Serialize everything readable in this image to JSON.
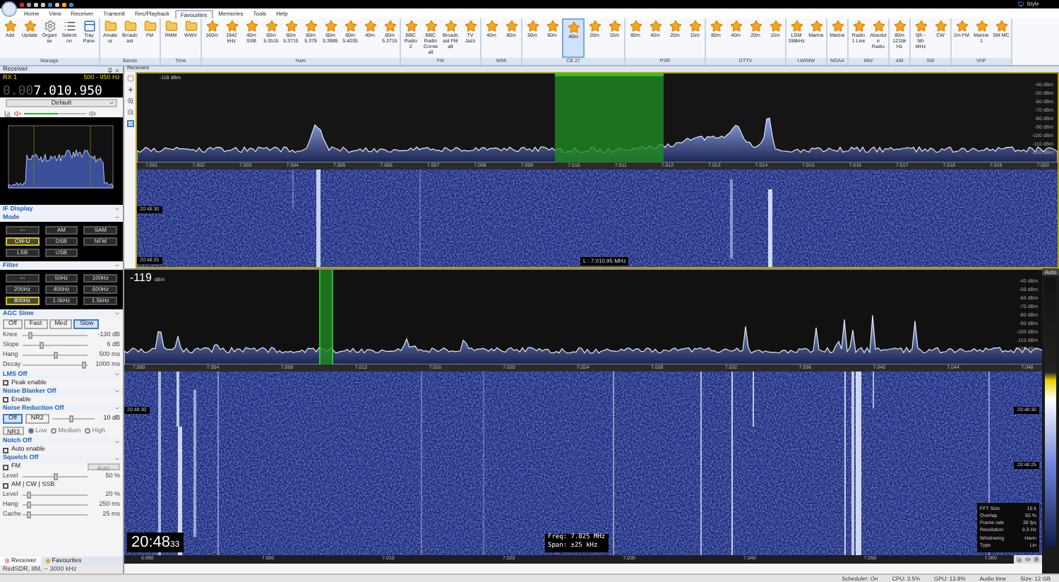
{
  "title_bar": {
    "style_menu": "Style"
  },
  "menu_tabs": [
    {
      "label": "Home",
      "selected": false
    },
    {
      "label": "View",
      "selected": false
    },
    {
      "label": "Receiver",
      "selected": false
    },
    {
      "label": "Transmit",
      "selected": false
    },
    {
      "label": "Rec/Playback",
      "selected": false
    },
    {
      "label": "Favourites",
      "selected": true
    },
    {
      "label": "Memories",
      "selected": false
    },
    {
      "label": "Tools",
      "selected": false
    },
    {
      "label": "Help",
      "selected": false
    }
  ],
  "ribbon_groups": [
    {
      "label": "Manage",
      "items": [
        {
          "label": "Add",
          "kind": "star",
          "selected": false
        },
        {
          "label": "Update",
          "kind": "star",
          "selected": false
        },
        {
          "label": "Organise",
          "kind": "gear",
          "selected": false
        },
        {
          "label": "Selection",
          "kind": "list",
          "selected": false
        },
        {
          "label": "Tray Pane",
          "kind": "pane",
          "selected": false
        }
      ]
    },
    {
      "label": "Bands",
      "items": [
        {
          "label": "Amateur",
          "kind": "folder",
          "selected": false
        },
        {
          "label": "Broadcast",
          "kind": "folder",
          "selected": false
        },
        {
          "label": "FM",
          "kind": "folder",
          "selected": false
        }
      ]
    },
    {
      "label": "Time",
      "items": [
        {
          "label": "RMM",
          "kind": "folder",
          "selected": false
        },
        {
          "label": "WWV",
          "kind": "folder",
          "selected": false
        }
      ]
    },
    {
      "label": "Ham",
      "items": [
        {
          "label": "160m",
          "kind": "star",
          "selected": false
        },
        {
          "label": "1942 kHz",
          "kind": "star",
          "selected": false
        },
        {
          "label": "40m SSB",
          "kind": "star",
          "selected": false
        },
        {
          "label": "60m 5.3515",
          "kind": "star",
          "selected": false
        },
        {
          "label": "60m 5.3715",
          "kind": "star",
          "selected": false
        },
        {
          "label": "60m 5.379",
          "kind": "star",
          "selected": false
        },
        {
          "label": "60m 5.3985",
          "kind": "star",
          "selected": false
        },
        {
          "label": "60m 5.4035",
          "kind": "star",
          "selected": false
        },
        {
          "label": "40m",
          "kind": "star",
          "selected": false
        },
        {
          "label": "60m 5.3715",
          "kind": "star",
          "selected": false
        }
      ]
    },
    {
      "label": "FM",
      "items": [
        {
          "label": "BBC Radio 2",
          "kind": "star",
          "selected": false
        },
        {
          "label": "BBC Radio Cornwall",
          "kind": "star",
          "selected": false
        },
        {
          "label": "Broadcast FM alt",
          "kind": "star",
          "selected": false
        },
        {
          "label": "TV Jazz",
          "kind": "star",
          "selected": false
        }
      ]
    },
    {
      "label": "WMI",
      "items": [
        {
          "label": "40m",
          "kind": "star",
          "selected": false
        },
        {
          "label": "80m",
          "kind": "star",
          "selected": false
        }
      ]
    },
    {
      "label": "CB 27",
      "items": [
        {
          "label": "50m",
          "kind": "star",
          "selected": false
        },
        {
          "label": "60m",
          "kind": "star",
          "selected": false
        },
        {
          "label": "40m",
          "kind": "star",
          "selected": true
        },
        {
          "label": "20m",
          "kind": "star",
          "selected": false
        },
        {
          "label": "15m",
          "kind": "star",
          "selected": false
        }
      ]
    },
    {
      "label": "PSR",
      "items": [
        {
          "label": "80m",
          "kind": "star",
          "selected": false
        },
        {
          "label": "40m",
          "kind": "star",
          "selected": false
        },
        {
          "label": "20m",
          "kind": "star",
          "selected": false
        },
        {
          "label": "15m",
          "kind": "star",
          "selected": false
        }
      ]
    },
    {
      "label": "DTTV",
      "items": [
        {
          "label": "80m",
          "kind": "star",
          "selected": false
        },
        {
          "label": "40m",
          "kind": "star",
          "selected": false
        },
        {
          "label": "20m",
          "kind": "star",
          "selected": false
        },
        {
          "label": "15m",
          "kind": "star",
          "selected": false
        }
      ]
    },
    {
      "label": "LW/MW",
      "items": [
        {
          "label": "LGM 198kHz",
          "kind": "star",
          "selected": false
        },
        {
          "label": "Marine",
          "kind": "star",
          "selected": false
        }
      ]
    },
    {
      "label": "NOAA",
      "items": [
        {
          "label": "Marine",
          "kind": "star",
          "selected": false
        }
      ]
    },
    {
      "label": "MW",
      "items": [
        {
          "label": "Radio 1 Live",
          "kind": "star",
          "selected": false
        },
        {
          "label": "Absolute Radio",
          "kind": "star",
          "selected": false
        }
      ]
    },
    {
      "label": "AM",
      "items": [
        {
          "label": "80m 1215kHz",
          "kind": "star",
          "selected": false
        }
      ]
    },
    {
      "label": "SW",
      "items": [
        {
          "label": "5th - 5th MHz",
          "kind": "star",
          "selected": false
        },
        {
          "label": "CW",
          "kind": "star",
          "selected": false
        }
      ]
    },
    {
      "label": "VHF",
      "items": [
        {
          "label": "2m FM",
          "kind": "star",
          "selected": false
        },
        {
          "label": "Marine 1",
          "kind": "star",
          "selected": false
        },
        {
          "label": "SM MC",
          "kind": "star",
          "selected": false
        }
      ]
    }
  ],
  "receiver_panel": {
    "title": "Receiver",
    "rx": "RX 1",
    "bandwidth": "500 - 950 Hz",
    "frequency_dim": "0.00",
    "frequency": "7.010.950",
    "preset": "Default",
    "volume": {
      "level": 0.55
    },
    "if_display": "IF Display",
    "mode": {
      "title": "Mode",
      "buttons": [
        {
          "label": "---",
          "selected": false
        },
        {
          "label": "AM",
          "selected": false
        },
        {
          "label": "SAM",
          "selected": false
        },
        {
          "label": "CW-U",
          "selected": true
        },
        {
          "label": "DSB",
          "selected": false
        },
        {
          "label": "NFM",
          "selected": false
        },
        {
          "label": "LSB",
          "selected": false
        },
        {
          "label": "USB",
          "selected": false
        }
      ]
    },
    "filter": {
      "title": "Filter",
      "buttons": [
        {
          "label": "---",
          "selected": false
        },
        {
          "label": "50Hz",
          "selected": false
        },
        {
          "label": "100Hz",
          "selected": false
        },
        {
          "label": "200Hz",
          "selected": false
        },
        {
          "label": "400Hz",
          "selected": false
        },
        {
          "label": "600Hz",
          "selected": false
        },
        {
          "label": "800Hz",
          "selected": true
        },
        {
          "label": "1.0kHz",
          "selected": false
        },
        {
          "label": "1.5kHz",
          "selected": false
        }
      ]
    },
    "agc": {
      "title": "AGC Slow",
      "buttons": [
        {
          "label": "Off",
          "selected": false
        },
        {
          "label": "Fast",
          "selected": false
        },
        {
          "label": "Med",
          "selected": false
        },
        {
          "label": "Slow",
          "selected": true
        }
      ],
      "sliders": [
        {
          "label": "Knee",
          "reading": "-130 dB",
          "level": 0.12
        },
        {
          "label": "Slope",
          "reading": "6 dB",
          "level": 0.3
        },
        {
          "label": "Hang",
          "reading": "500 ms",
          "level": 0.5
        },
        {
          "label": "Decay",
          "reading": "1000 ms",
          "level": 0.95
        }
      ]
    },
    "lms": {
      "title": "LMS Off",
      "checkbox": {
        "label": "Peak enable",
        "checked": false
      }
    },
    "noise_blanker": {
      "title": "Noise Blanker Off",
      "checkbox": {
        "label": "Enable",
        "checked": false
      }
    },
    "noise_reduction": {
      "title": "Noise Reduction Off",
      "buttons": [
        {
          "label": "Off",
          "selected": true
        },
        {
          "label": "NR2",
          "selected": false
        }
      ],
      "slider": {
        "reading": "10 dB",
        "level": 0.45
      },
      "nr3": "NR3",
      "options": [
        {
          "label": "Low",
          "selected": true
        },
        {
          "label": "Medium",
          "selected": false
        },
        {
          "label": "High",
          "selected": false
        }
      ]
    },
    "notch": {
      "title": "Notch Off",
      "checkbox": {
        "label": "Auto enable",
        "checked": false
      }
    },
    "squelch": {
      "title": "Squelch Off",
      "fm": {
        "label": "FM",
        "checked": false
      },
      "auto_button": "Auto",
      "level": {
        "label": "Level",
        "reading": "50 %",
        "level": 0.5
      },
      "am": {
        "label": "AM | CW | SSB",
        "checked": false
      },
      "sliders": [
        {
          "label": "Level",
          "reading": "20 %",
          "level": 0.1
        },
        {
          "label": "Hang",
          "reading": "250 ms",
          "level": 0.1
        },
        {
          "label": "Cache",
          "reading": "25 ms",
          "level": 0.1
        }
      ]
    }
  },
  "bottom_tabs": [
    {
      "label": "Receiver",
      "selected": true
    },
    {
      "label": "Favourites",
      "selected": false
    }
  ],
  "left_status": "RedSDR, 8M, -- 3000 kHz",
  "receivers_title": "Receivers",
  "spectrum_top": {
    "reading": "-119 dBm",
    "db_labels": [
      "-40 dBm",
      "-50 dBm",
      "-60 dBm",
      "-70 dBm",
      "-80 dBm",
      "-90 dBm",
      "-100 dBm",
      "-110 dBm",
      "-120 dBm"
    ],
    "freq_labels": [
      "7.001",
      "7.002",
      "7.003",
      "7.004",
      "7.005",
      "7.006",
      "7.007",
      "7.008",
      "7.009",
      "7.010",
      "7.011",
      "7.012",
      "7.013",
      "7.014",
      "7.015",
      "7.016",
      "7.017",
      "7.018",
      "7.019",
      "7.020"
    ]
  },
  "waterfall_top": {
    "timestamps": [
      "20:48:30",
      "20:48:25"
    ],
    "marker": "L : 7.010.95 MHz"
  },
  "spectrum_bottom": {
    "reading": "-119",
    "unit": "dBm",
    "db_labels": [
      "-40 dBm",
      "-50 dBm",
      "-60 dBm",
      "-70 dBm",
      "-80 dBm",
      "-90 dBm",
      "-100 dBm",
      "-110 dBm",
      "-120 dBm"
    ],
    "freq_labels": [
      "7.000",
      "7.004",
      "7.008",
      "7.012",
      "7.016",
      "7.020",
      "7.024",
      "7.028",
      "7.032",
      "7.036",
      "7.040",
      "7.044",
      "7.048"
    ]
  },
  "waterfall_bottom": {
    "timestamps": [
      "20:48:30",
      "20:48:30",
      "20:48:25"
    ],
    "clock": "20:48",
    "clock_seconds": "33",
    "freq": "Freq: 7.025 MHz",
    "span": "Span: ±25 kHz",
    "info": [
      {
        "label": "FFT Size",
        "value": "16 k"
      },
      {
        "label": "Overlap",
        "value": "50 %"
      },
      {
        "label": "Frame rate",
        "value": "30 fps"
      },
      {
        "label": "Resolution",
        "value": "0.3 Hz"
      },
      {
        "label": "Windowing",
        "value": "Hann"
      },
      {
        "label": "Type",
        "value": "Lin"
      }
    ],
    "axis_labels": [
      "6.990",
      "7.000",
      "7.010",
      "7.020",
      "7.030",
      "7.040",
      "7.050",
      "7.060"
    ]
  },
  "scale_label": "Auto",
  "status_bar": [
    "Scheduler: On",
    "CPU: 3.5%",
    "GPU: 13.8%",
    "Audio time",
    "Size: 12 GB"
  ]
}
